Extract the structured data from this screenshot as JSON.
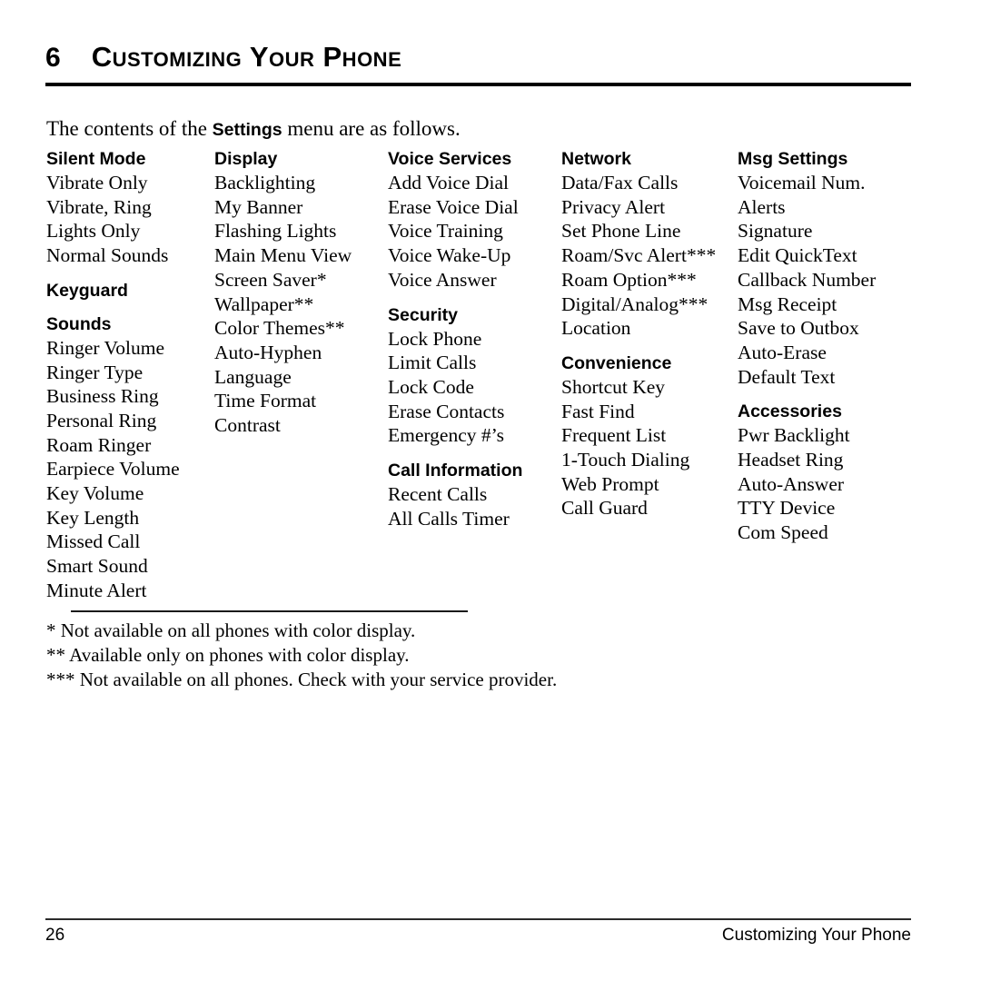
{
  "chapter": {
    "number": "6",
    "title": "Customizing Your Phone"
  },
  "intro": {
    "before": "The contents of the ",
    "keyword": "Settings",
    "after": " menu are as follows."
  },
  "columns": [
    {
      "groups": [
        {
          "heading": "Silent Mode",
          "items": [
            "Vibrate Only",
            "Vibrate, Ring",
            "Lights Only",
            "Normal Sounds"
          ]
        },
        {
          "heading": "Keyguard",
          "items": []
        },
        {
          "heading": "Sounds",
          "items": [
            "Ringer Volume",
            "Ringer Type",
            "Business Ring",
            "Personal Ring",
            "Roam Ringer",
            "Earpiece Volume",
            "Key Volume",
            "Key Length",
            "Missed Call",
            "Smart Sound",
            "Minute Alert"
          ]
        }
      ]
    },
    {
      "groups": [
        {
          "heading": "Display",
          "items": [
            "Backlighting",
            "My Banner",
            "Flashing Lights",
            "Main Menu View",
            "Screen Saver*",
            "Wallpaper**",
            "Color Themes**",
            "Auto-Hyphen",
            "Language",
            "Time Format",
            "Contrast"
          ]
        }
      ]
    },
    {
      "groups": [
        {
          "heading": "Voice Services",
          "items": [
            "Add Voice Dial",
            "Erase Voice Dial",
            "Voice Training",
            "Voice Wake-Up",
            "Voice Answer"
          ]
        },
        {
          "heading": "Security",
          "items": [
            "Lock Phone",
            "Limit Calls",
            "Lock Code",
            "Erase Contacts",
            "Emergency #’s"
          ]
        },
        {
          "heading": "Call Information",
          "items": [
            "Recent Calls",
            "All Calls Timer"
          ]
        }
      ]
    },
    {
      "groups": [
        {
          "heading": "Network",
          "items": [
            "Data/Fax Calls",
            "Privacy Alert",
            "Set Phone Line",
            "Roam/Svc Alert***",
            "Roam Option***",
            "Digital/Analog***",
            "Location"
          ]
        },
        {
          "heading": "Convenience",
          "items": [
            "Shortcut Key",
            "Fast Find",
            "Frequent List",
            "1-Touch Dialing",
            "Web Prompt",
            "Call Guard"
          ]
        }
      ]
    },
    {
      "groups": [
        {
          "heading": "Msg Settings",
          "items": [
            "Voicemail Num.",
            "Alerts",
            "Signature",
            "Edit QuickText",
            "Callback Number",
            "Msg Receipt",
            "Save to Outbox",
            "Auto-Erase",
            "Default Text"
          ]
        },
        {
          "heading": "Accessories",
          "items": [
            "Pwr Backlight",
            "Headset Ring",
            "Auto-Answer",
            "TTY Device",
            "Com Speed"
          ]
        }
      ]
    }
  ],
  "footnotes": [
    "* Not available on all phones with color display.",
    "** Available only on phones with color display.",
    "*** Not available on all phones. Check with your service provider."
  ],
  "footer": {
    "page_number": "26",
    "running_title": "Customizing Your Phone"
  }
}
